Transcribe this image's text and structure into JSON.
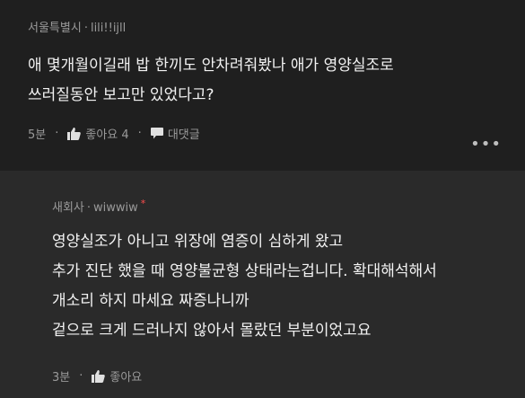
{
  "comment": {
    "author": "서울특별시",
    "handle": "lili!!ijll",
    "lines": [
      "애 몇개월이길래 밥 한끼도 안차려줘봤나 애가 영양실조로",
      "쓰러질동안 보고만 있었다고?"
    ],
    "time": "5분",
    "like_label": "좋아요 4",
    "reply_label": "대댓글",
    "more_label": "•••"
  },
  "reply": {
    "author": "새회사",
    "handle": "wiwwiw",
    "badge": "*",
    "lines": [
      "영양실조가 아니고 위장에 염증이 심하게 왔고",
      "추가 진단 했을 때 영양불균형 상태라는겁니다. 확대해석해서",
      "개소리 하지 마세요 짜증나니까",
      "겉으로 크게 드러나지 않아서 몰랐던 부분이었고요"
    ],
    "time": "3분",
    "like_label": "좋아요"
  },
  "colors": {
    "background": "#1f1f1f",
    "reply_background": "#2a2a2a",
    "text": "#f2f2f2",
    "meta": "#9a9a9a",
    "badge": "#ff4d4d"
  }
}
